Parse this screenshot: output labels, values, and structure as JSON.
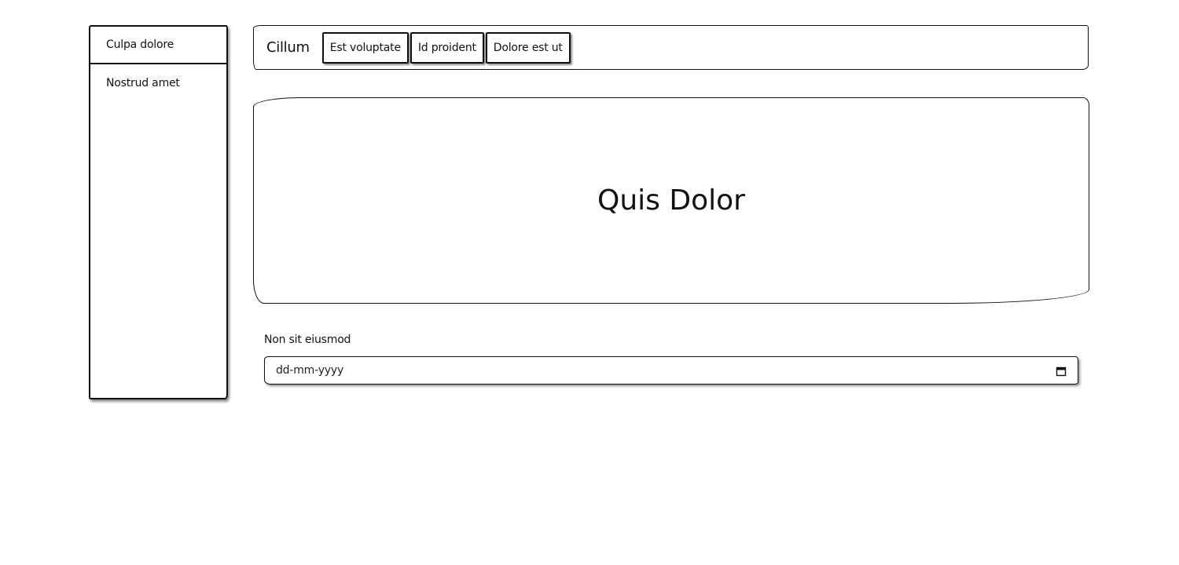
{
  "sidebar": {
    "items": [
      {
        "label": "Culpa dolore"
      },
      {
        "label": "Nostrud amet"
      }
    ]
  },
  "navbar": {
    "brand": "Cillum",
    "buttons": [
      {
        "label": "Est voluptate"
      },
      {
        "label": "Id proident"
      },
      {
        "label": "Dolore est ut"
      }
    ]
  },
  "hero": {
    "title": "Quis Dolor"
  },
  "form": {
    "date_label": "Non sit eiusmod",
    "date_placeholder": "dd-mm-yyyy",
    "date_icon": "calendar-icon"
  }
}
